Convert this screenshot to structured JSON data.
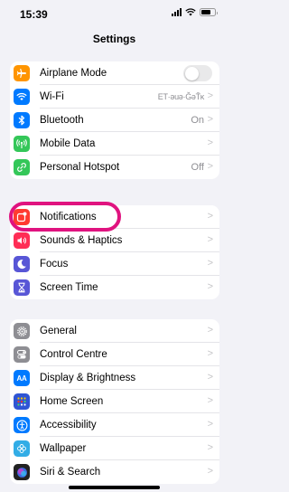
{
  "status_bar": {
    "time": "15:39",
    "battery_level": 0.7
  },
  "header": {
    "title": "Settings"
  },
  "groups": [
    {
      "items": [
        {
          "label": "Airplane Mode",
          "icon": "airplane-icon",
          "icon_color": "#ff9500",
          "control": "toggle",
          "toggle_on": false
        },
        {
          "label": "Wi-Fi",
          "icon": "wifi-icon",
          "icon_color": "#007aff",
          "value": "ET·ǝuǝ·ĞǝŤĸ",
          "control": "chevron"
        },
        {
          "label": "Bluetooth",
          "icon": "bluetooth-icon",
          "icon_color": "#007aff",
          "value": "On",
          "control": "chevron"
        },
        {
          "label": "Mobile Data",
          "icon": "antenna-icon",
          "icon_color": "#34c759",
          "control": "chevron"
        },
        {
          "label": "Personal Hotspot",
          "icon": "hotspot-icon",
          "icon_color": "#34c759",
          "value": "Off",
          "control": "chevron"
        }
      ]
    },
    {
      "items": [
        {
          "label": "Notifications",
          "icon": "notifications-icon",
          "icon_color": "#ff3b30",
          "control": "chevron",
          "highlighted": true
        },
        {
          "label": "Sounds & Haptics",
          "icon": "speaker-icon",
          "icon_color": "#ff2d55",
          "control": "chevron"
        },
        {
          "label": "Focus",
          "icon": "moon-icon",
          "icon_color": "#5856d6",
          "control": "chevron"
        },
        {
          "label": "Screen Time",
          "icon": "hourglass-icon",
          "icon_color": "#5856d6",
          "control": "chevron"
        }
      ]
    },
    {
      "items": [
        {
          "label": "General",
          "icon": "gear-icon",
          "icon_color": "#8e8e93",
          "control": "chevron"
        },
        {
          "label": "Control Centre",
          "icon": "switches-icon",
          "icon_color": "#8e8e93",
          "control": "chevron"
        },
        {
          "label": "Display & Brightness",
          "icon": "display-icon",
          "icon_color": "#007aff",
          "icon_text": "AA",
          "control": "chevron"
        },
        {
          "label": "Home Screen",
          "icon": "home-grid-icon",
          "icon_color": "#2f55d4",
          "control": "chevron"
        },
        {
          "label": "Accessibility",
          "icon": "accessibility-icon",
          "icon_color": "#007aff",
          "control": "chevron"
        },
        {
          "label": "Wallpaper",
          "icon": "wallpaper-icon",
          "icon_color": "#32ade6",
          "control": "chevron"
        },
        {
          "label": "Siri & Search",
          "icon": "siri-icon",
          "icon_color": "#222222",
          "control": "chevron"
        }
      ]
    }
  ],
  "chevron_glyph": ">"
}
